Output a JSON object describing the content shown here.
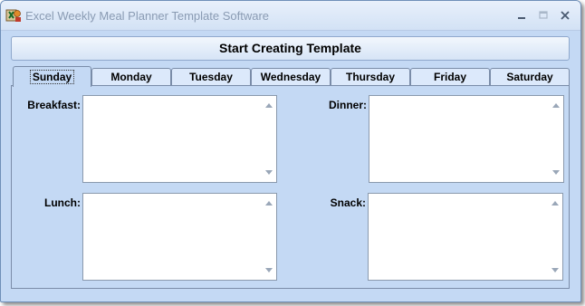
{
  "window": {
    "title": "Excel Weekly Meal Planner Template Software"
  },
  "toolbar": {
    "start_label": "Start Creating Template"
  },
  "tabs": [
    {
      "label": "Sunday"
    },
    {
      "label": "Monday"
    },
    {
      "label": "Tuesday"
    },
    {
      "label": "Wednesday"
    },
    {
      "label": "Thursday"
    },
    {
      "label": "Friday"
    },
    {
      "label": "Saturday"
    }
  ],
  "active_tab": "Sunday",
  "fields": {
    "breakfast": {
      "label": "Breakfast:",
      "value": ""
    },
    "dinner": {
      "label": "Dinner:",
      "value": ""
    },
    "lunch": {
      "label": "Lunch:",
      "value": ""
    },
    "snack": {
      "label": "Snack:",
      "value": ""
    }
  },
  "icons": {
    "app": "meal-planner-app-icon",
    "minimize": "minimize-icon",
    "maximize": "maximize-icon",
    "close": "close-icon"
  },
  "colors": {
    "window_bg": "#c4d9f4",
    "title_text": "#8a9bb3",
    "tab_bg": "#dce9fb"
  }
}
